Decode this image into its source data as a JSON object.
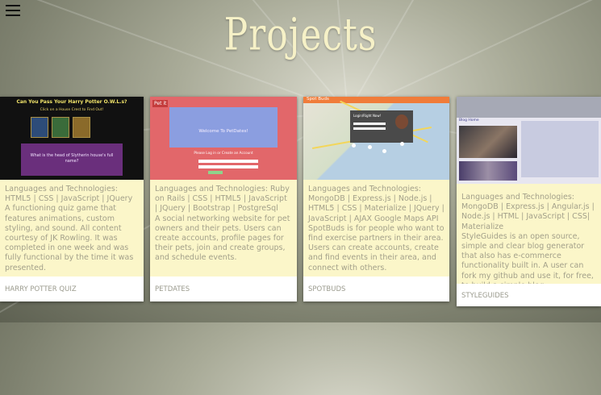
{
  "menu": {
    "icon": "hamburger-icon"
  },
  "page_title": "Projects",
  "projects": [
    {
      "thumb": {
        "title": "Can You Pass Your Harry Potter O.W.L.s?",
        "subtitle": "Click on a House Crest to Find Out!",
        "question": "What is the head of Slytherin house's full name?"
      },
      "technologies": "Languages and Technologies: HTML5 | CSS | JavaScript | JQuery",
      "description": "A functioning quiz game that features animations, custom styling, and sound. All content courtesy of JK Rowling. It was completed in one week and was fully functional by the time it was presented.",
      "name": "Harry Potter Quiz"
    },
    {
      "thumb": {
        "logo": "Pet it",
        "title": "Welcome To PetDates!",
        "cta": "Please Log in or Create an Account"
      },
      "technologies": "Languages and Technologies: Ruby on Rails | CSS | HTML5 | JavaScript | JQuery | Bootstrap | PostgreSql",
      "description": "A social networking website for pet owners and their pets. Users can create accounts, profile pages for their pets, join and create groups, and schedule events.",
      "name": "PetDates"
    },
    {
      "thumb": {
        "logo": "Spot Buds",
        "panel": "Login/Right Now!"
      },
      "technologies": "Languages and Technologies: MongoDB | Express.js | Node.js | HTML5 | CSS | Materialize | JQuery | JavaScript | AJAX Google Maps API",
      "description": "SpotBuds is for people who want to find exercise partners in their area. Users can create accounts, create and find events in their area, and connect with others.",
      "name": "SpotBuds"
    },
    {
      "thumb": {
        "header": "Blog Home"
      },
      "technologies": "Languages and Technologies: MongoDB | Express.js | Angular.js | Node.js | HTML | JavaScript | CSS| Materialize",
      "description": "StyleGuides is an open source, simple and clear blog generator that also has e-commerce functionality built in. A user can fork my github and use it, for free, to build a simple blog.",
      "name": "StyleGuides"
    }
  ]
}
